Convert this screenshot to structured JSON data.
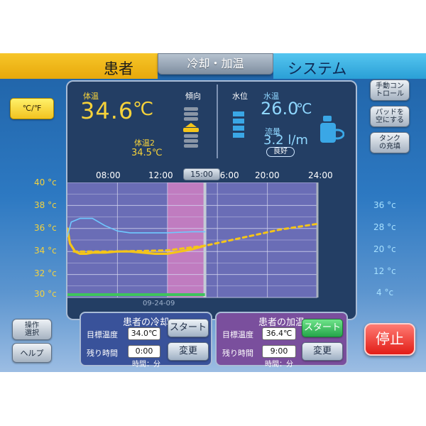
{
  "tabs": {
    "patient": "患者",
    "cool_heat": "冷却・加温",
    "system": "システム"
  },
  "unit_button": "℃/℉",
  "side_buttons": {
    "manual_control": [
      "手動コン",
      "トロール"
    ],
    "empty_pad": [
      "パッドを",
      "空にする"
    ],
    "fill_tank": [
      "タンク",
      "の充填"
    ],
    "operation_select": [
      "操作",
      "選択"
    ],
    "help": "ヘルプ"
  },
  "status": {
    "body_temp_label": "体温",
    "body_temp_value": "34.6",
    "body_temp_unit": "℃",
    "trend_label": "傾向",
    "body_temp2_label": "体温2",
    "body_temp2_value": "34.5℃",
    "water_level_label": "水位",
    "water_temp_label": "水温",
    "water_temp_value": "26.0",
    "water_temp_unit": "℃",
    "flow_label": "流量",
    "flow_value": "3.2 l/m",
    "flow_status": "良好"
  },
  "timeline": {
    "labels": [
      "08:00",
      "12:00",
      "16:00",
      "20:00",
      "24:00"
    ],
    "marker": "15:00",
    "date": "09-24-09"
  },
  "chart_data": {
    "type": "line",
    "x_unit": "hour",
    "xlim": [
      4,
      24
    ],
    "left_axis": {
      "ticks": [
        "40 °c",
        "38 °c",
        "36 °c",
        "34 °c",
        "32 °c",
        "30 °c"
      ],
      "ylim": [
        30,
        40
      ]
    },
    "right_axis": {
      "ticks": [
        "36 °c",
        "28 °c",
        "20 °c",
        "12 °c",
        "4 °c"
      ],
      "ylim": [
        4,
        36
      ]
    },
    "series": [
      {
        "color": "#f5c518",
        "style": "solid",
        "x": [
          4.0,
          4.2,
          4.6,
          5.0,
          5.5,
          6.0,
          7.0,
          8.0,
          9.0,
          10.0,
          11.0,
          12.0,
          13.0,
          14.0,
          15.0
        ],
        "y": [
          36.0,
          34.7,
          34.0,
          33.8,
          33.8,
          33.9,
          33.9,
          34.0,
          34.0,
          33.9,
          33.8,
          33.8,
          34.0,
          34.2,
          34.5
        ]
      },
      {
        "color": "#f5c518",
        "style": "dotted",
        "x": [
          4.5,
          8.0,
          12.0,
          15.0,
          18.0,
          21.0,
          24.0
        ],
        "y": [
          34.0,
          34.0,
          34.1,
          34.5,
          35.2,
          35.9,
          36.4
        ]
      },
      {
        "color": "#6ec9ff",
        "style": "solid",
        "axis": "right",
        "x": [
          4.0,
          4.3,
          5.0,
          6.0,
          7.0,
          8.0,
          9.0,
          10.0,
          12.0,
          14.0,
          15.0
        ],
        "y": [
          21.0,
          25.0,
          26.0,
          26.0,
          24.0,
          22.5,
          22.0,
          22.0,
          22.0,
          22.3,
          22.3
        ]
      }
    ],
    "shaded_region": {
      "x_from": 12,
      "x_to": 15,
      "color": "#c07cc0"
    }
  },
  "cooling_panel": {
    "title": "患者の冷却",
    "target_label": "目標温度",
    "target_value": "34.0℃",
    "remaining_label": "残り時間",
    "remaining_value": "0:00",
    "time_unit": "時間：分",
    "start": "スタート",
    "change": "変更"
  },
  "heating_panel": {
    "title": "患者の加温",
    "target_label": "目標温度",
    "target_value": "36.4℃",
    "remaining_label": "残り時間",
    "remaining_value": "9:00",
    "time_unit": "時間：分",
    "start": "スタート",
    "change": "変更"
  },
  "stop_button": "停止"
}
